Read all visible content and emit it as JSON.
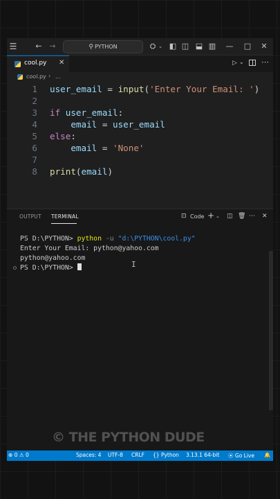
{
  "titlebar": {
    "search_text": "PYTHON",
    "icons": [
      "menu-icon",
      "back-arrow-icon",
      "forward-arrow-icon",
      "search-icon",
      "copilot-icon",
      "layout-sidebar-icon",
      "layout-panel-icon",
      "layout-secondary-icon",
      "customize-layout-icon",
      "minimize-icon",
      "maximize-icon",
      "close-icon"
    ]
  },
  "tabs": [
    {
      "label": "cool.py",
      "close": "✕"
    }
  ],
  "breadcrumb": {
    "file": "cool.py",
    "sep": "›",
    "more": "..."
  },
  "editor": {
    "line_numbers": [
      "1",
      "2",
      "3",
      "4",
      "5",
      "6",
      "7",
      "8"
    ],
    "lines": [
      [
        [
          "var",
          "user_email"
        ],
        [
          "plain",
          " = "
        ],
        [
          "fn",
          "input"
        ],
        [
          "plain",
          "("
        ],
        [
          "str",
          "'Enter Your Email: '"
        ],
        [
          "plain",
          ")"
        ]
      ],
      [],
      [
        [
          "kw",
          "if"
        ],
        [
          "plain",
          " "
        ],
        [
          "var",
          "user_email"
        ],
        [
          "plain",
          ":"
        ]
      ],
      [
        [
          "plain",
          "    "
        ],
        [
          "var",
          "email"
        ],
        [
          "plain",
          " = "
        ],
        [
          "var",
          "user_email"
        ]
      ],
      [
        [
          "kw",
          "else"
        ],
        [
          "plain",
          ":"
        ]
      ],
      [
        [
          "plain",
          "    "
        ],
        [
          "var",
          "email"
        ],
        [
          "plain",
          " = "
        ],
        [
          "str",
          "'None'"
        ]
      ],
      [],
      [
        [
          "fn",
          "print"
        ],
        [
          "plain",
          "("
        ],
        [
          "var",
          "email"
        ],
        [
          "plain",
          ")"
        ]
      ]
    ]
  },
  "panel": {
    "tabs": {
      "output": "OUTPUT",
      "terminal": "TERMINAL"
    },
    "shell_label": "Code",
    "terminal": {
      "line1_prompt": "PS D:\\PYTHON> ",
      "line1_cmd": "python",
      "line1_flag": " -u ",
      "line1_arg": "\"d:\\PYTHON\\cool.py\"",
      "line2": "Enter Your Email: python@yahoo.com",
      "line3": "python@yahoo.com",
      "line4_prompt": "PS D:\\PYTHON> "
    }
  },
  "statusbar": {
    "errors": "0",
    "warnings": "0",
    "spaces": "Spaces: 4",
    "encoding": "UTF-8",
    "eol": "CRLF",
    "language": "Python",
    "interpreter": "3.13.1 64-bit",
    "live": "Go Live",
    "accent": "#007acc"
  },
  "watermark": "© THE PYTHON DUDE"
}
